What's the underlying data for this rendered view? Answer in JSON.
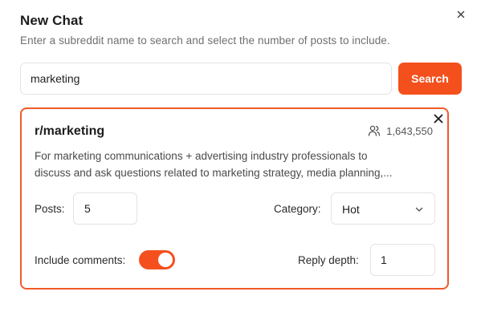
{
  "dialog": {
    "title": "New Chat",
    "subtitle": "Enter a subreddit name to search and select the number of posts to include.",
    "close_icon": "close-icon"
  },
  "search": {
    "value": "marketing",
    "button_label": "Search",
    "accent_color": "#f4501d"
  },
  "subreddit_card": {
    "name": "r/marketing",
    "members": "1,643,550",
    "members_icon": "users-icon",
    "description_line1": "For marketing communications + advertising industry professionals to",
    "description_line2": "discuss and ask questions related to marketing strategy, media planning,...",
    "border_color": "#ef5a28",
    "posts": {
      "label": "Posts:",
      "value": "5"
    },
    "category": {
      "label": "Category:",
      "selected": "Hot"
    },
    "include_comments": {
      "label": "Include comments:",
      "enabled": true
    },
    "reply_depth": {
      "label": "Reply depth:",
      "value": "1"
    }
  }
}
